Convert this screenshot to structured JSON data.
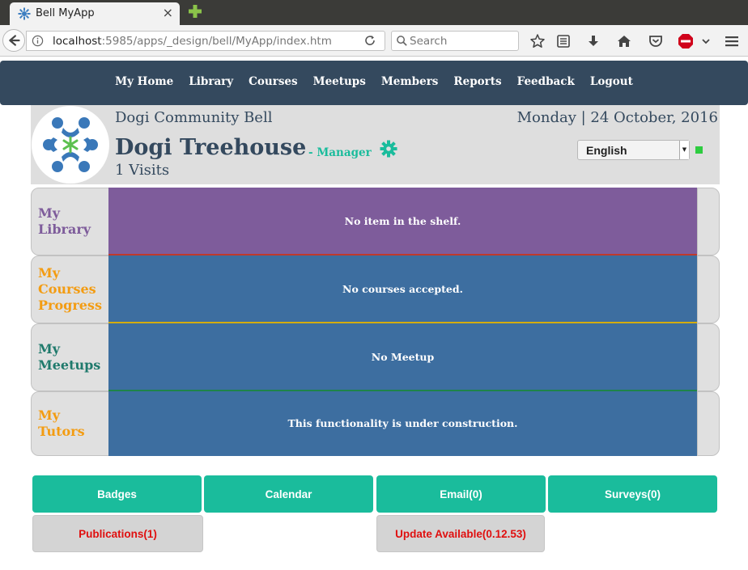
{
  "browser": {
    "tab_title": "Bell MyApp",
    "tab_close": "×",
    "url_host": "localhost",
    "url_path": ":5985/apps/_design/bell/MyApp/index.htm",
    "search_placeholder": "Search"
  },
  "nav": {
    "items": [
      "My Home",
      "Library",
      "Courses",
      "Meetups",
      "Members",
      "Reports",
      "Feedback",
      "Logout"
    ]
  },
  "profile": {
    "community": "Dogi Community Bell",
    "date": "Monday | 24 October, 2016",
    "name": "Dogi Treehouse",
    "role_prefix": "-",
    "role": "Manager",
    "visits": "1 Visits",
    "language": "English",
    "status_color": "#2ecc40"
  },
  "rows": [
    {
      "label": "My\nLibrary",
      "label_color": "#7e5c9b",
      "message": "No item in the shelf.",
      "body_color": "#7e5c9b",
      "accent_color": "#c0392b"
    },
    {
      "label": "My\nCourses\nProgress",
      "label_color": "#f39c12",
      "message": "No courses accepted.",
      "body_color": "#3d6ea0",
      "accent_color": "#d4ac0d"
    },
    {
      "label": "My\nMeetups",
      "label_color": "#1f7a6c",
      "message": "No Meetup",
      "body_color": "#3d6ea0",
      "accent_color": "#1e8449"
    },
    {
      "label": "My\nTutors",
      "label_color": "#f39c12",
      "message": "This functionality is under construction.",
      "body_color": "#3d6ea0",
      "accent_color": "#3d6ea0"
    }
  ],
  "buttons": {
    "badges": "Badges",
    "calendar": "Calendar",
    "email": "Email(0)",
    "surveys": "Surveys(0)",
    "publications": "Publications(1)",
    "update": "Update Available(0.12.53)"
  },
  "colors": {
    "header_bg": "#34495e",
    "accent": "#1abc9c",
    "alert_text": "#e00f0f"
  }
}
